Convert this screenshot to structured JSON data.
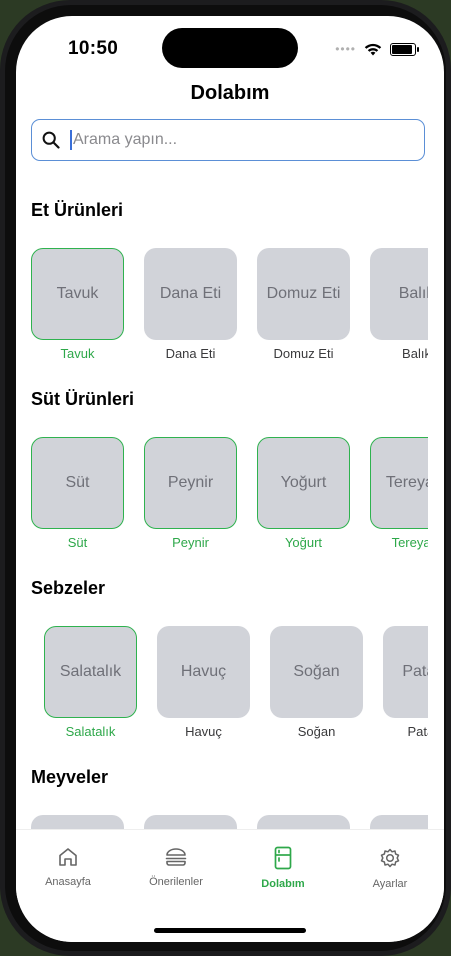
{
  "status": {
    "time": "10:50"
  },
  "header": {
    "title": "Dolabım"
  },
  "search": {
    "placeholder": "Arama yapın..."
  },
  "categories": [
    {
      "title": "Et Ürünleri",
      "items": [
        {
          "label": "Tavuk",
          "selected": true
        },
        {
          "label": "Dana Eti",
          "selected": false
        },
        {
          "label": "Domuz Eti",
          "selected": false
        },
        {
          "label": "Balık",
          "selected": false
        }
      ]
    },
    {
      "title": "Süt Ürünleri",
      "items": [
        {
          "label": "Süt",
          "selected": true
        },
        {
          "label": "Peynir",
          "selected": true
        },
        {
          "label": "Yoğurt",
          "selected": true
        },
        {
          "label": "Tereyağı",
          "selected": true
        }
      ]
    },
    {
      "title": "Sebzeler",
      "items": [
        {
          "label": "Salatalık",
          "selected": true
        },
        {
          "label": "Havuç",
          "selected": false
        },
        {
          "label": "Soğan",
          "selected": false
        },
        {
          "label": "Patates",
          "selected": false
        }
      ]
    },
    {
      "title": "Meyveler",
      "items": [
        {
          "label": "",
          "selected": false
        },
        {
          "label": "",
          "selected": false
        },
        {
          "label": "",
          "selected": false
        },
        {
          "label": "",
          "selected": false
        }
      ]
    }
  ],
  "tabbar": {
    "tabs": [
      {
        "label": "Anasayfa",
        "icon": "home-icon"
      },
      {
        "label": "Önerilenler",
        "icon": "burger-icon"
      },
      {
        "label": "Dolabım",
        "icon": "fridge-icon"
      },
      {
        "label": "Ayarlar",
        "icon": "gear-icon"
      }
    ],
    "active": "Dolabım"
  },
  "colors": {
    "accent": "#2ea84a",
    "tile": "#d1d3d9",
    "search_border": "#5b8fd6"
  }
}
